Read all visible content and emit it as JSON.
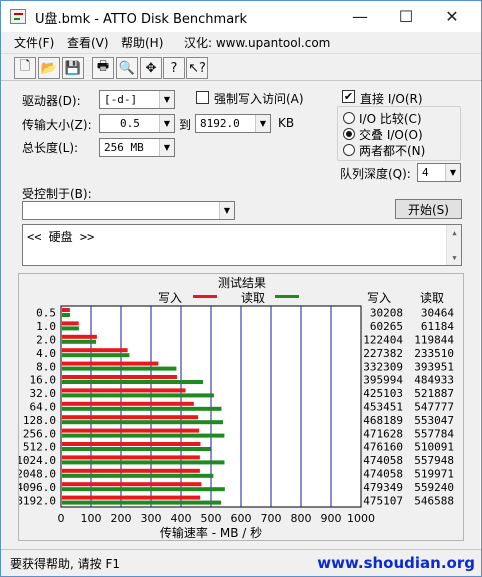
{
  "window": {
    "title": "U盘.bmk - ATTO Disk Benchmark",
    "minimize": "—",
    "maximize": "☐",
    "close": "✕"
  },
  "menu": [
    {
      "label": "文件(F)"
    },
    {
      "label": "查看(V)"
    },
    {
      "label": "帮助(H)"
    },
    {
      "label": "汉化: www.upantool.com"
    }
  ],
  "toolbar": [
    {
      "name": "new-icon",
      "glyph": "🗋"
    },
    {
      "name": "open-icon",
      "glyph": "📂"
    },
    {
      "name": "save-icon",
      "glyph": "💾"
    },
    {
      "name": "print-icon",
      "glyph": "🖶"
    },
    {
      "name": "print-preview-icon",
      "glyph": "🔍"
    },
    {
      "name": "move-icon",
      "glyph": "✥"
    },
    {
      "name": "help-icon",
      "glyph": "?"
    },
    {
      "name": "context-help-icon",
      "glyph": "↖?"
    }
  ],
  "settings": {
    "drive_label": "驱动器(D):",
    "drive_value": "[-d-]",
    "force_write_label": "强制写入访问(A)",
    "transfer_label": "传输大小(Z):",
    "transfer_from": "0.5",
    "to_label": "到",
    "transfer_to": "8192.0",
    "unit_kb": "KB",
    "length_label": "总长度(L):",
    "length_value": "256 MB",
    "direct_io_label": "直接 I/O(R)",
    "io_compare_label": "I/O 比较(C)",
    "overlapped_io_label": "交叠 I/O(O)",
    "neither_label": "两者都不(N)",
    "queue_label": "队列深度(Q):",
    "queue_value": "4",
    "controlled_by_label": "受控制于(B):",
    "controlled_by_value": "",
    "start_button": "开始(S)"
  },
  "description": "<<  硬盘    >>",
  "results": {
    "title": "测试结果",
    "write_legend": "写入",
    "read_legend": "读取",
    "write_col": "写入",
    "read_col": "读取",
    "xlabel": "传输速率 - MB / 秒",
    "write_color": "#e8191c",
    "read_color": "#1f8a1f"
  },
  "chart_data": {
    "type": "bar",
    "orientation": "horizontal",
    "categories": [
      "0.5",
      "1.0",
      "2.0",
      "4.0",
      "8.0",
      "16.0",
      "32.0",
      "64.0",
      "128.0",
      "256.0",
      "512.0",
      "1024.0",
      "2048.0",
      "4096.0",
      "8192.0"
    ],
    "series": [
      {
        "name": "写入",
        "values": [
          30208,
          60265,
          122404,
          227382,
          332309,
          395994,
          425103,
          453451,
          468189,
          471628,
          476160,
          474058,
          474058,
          479349,
          475107
        ]
      },
      {
        "name": "读取",
        "values": [
          30464,
          61184,
          119844,
          233510,
          393951,
          484933,
          521887,
          547777,
          553047,
          557784,
          510091,
          557948,
          519971,
          559240,
          546588
        ]
      }
    ],
    "x_ticks": [
      "0",
      "100",
      "200",
      "300",
      "400",
      "500",
      "600",
      "700",
      "800",
      "900",
      "1000"
    ],
    "xlim": [
      0,
      1000
    ],
    "xlabel": "传输速率 - MB / 秒",
    "value_unit_note": "raw values in KB/s as printed"
  },
  "status": {
    "text": "要获得帮助, 请按 F1",
    "watermark": "www.shoudian.org"
  }
}
